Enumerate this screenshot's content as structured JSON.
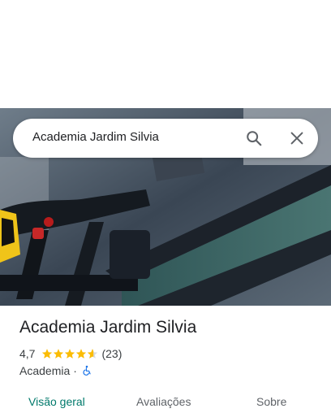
{
  "search": {
    "query": "Academia Jardim Silvia",
    "icons": {
      "search": "search-icon",
      "close": "close-icon"
    }
  },
  "photo": {
    "subject": "treadmill-photo"
  },
  "place": {
    "name": "Academia Jardim Silvia",
    "rating": "4,7",
    "rating_value": 4.7,
    "review_count": "(23)",
    "category": "Academia",
    "separator": "·",
    "accessibility_icon": "wheelchair-icon"
  },
  "tabs": [
    {
      "label": "Visão geral",
      "active": true
    },
    {
      "label": "Avaliações",
      "active": false
    },
    {
      "label": "Sobre",
      "active": false
    }
  ],
  "colors": {
    "accent": "#00796b",
    "star": "#fbbc04",
    "access": "#1a73e8"
  }
}
